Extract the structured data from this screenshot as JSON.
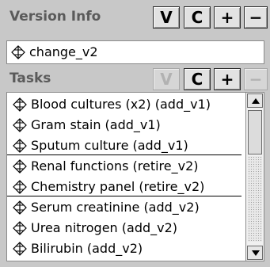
{
  "version_info": {
    "title": "Version Info",
    "buttons": {
      "v": "V",
      "c": "C",
      "plus": "+",
      "minus": "−"
    },
    "items": [
      {
        "label": "change_v2"
      }
    ]
  },
  "tasks": {
    "title": "Tasks",
    "buttons": {
      "v": "V",
      "c": "C",
      "plus": "+",
      "minus": "−"
    },
    "items": [
      {
        "label": "Blood cultures (x2) (add_v1)"
      },
      {
        "label": "Gram stain (add_v1)"
      },
      {
        "label": "Sputum culture (add_v1)"
      },
      {
        "label": "Renal functions (retire_v2)"
      },
      {
        "label": "Chemistry panel (retire_v2)"
      },
      {
        "label": "Serum creatinine (add_v2)"
      },
      {
        "label": "Urea nitrogen (add_v2)"
      },
      {
        "label": "Bilirubin (add_v2)"
      }
    ]
  },
  "icons": {
    "item": "diamond-compass-icon",
    "scroll_up": "arrow-up-icon",
    "scroll_down": "arrow-down-icon"
  },
  "colors": {
    "panel": "#c8c8c8",
    "header_text": "#5a5a5a",
    "disabled": "#b2b2b2"
  }
}
